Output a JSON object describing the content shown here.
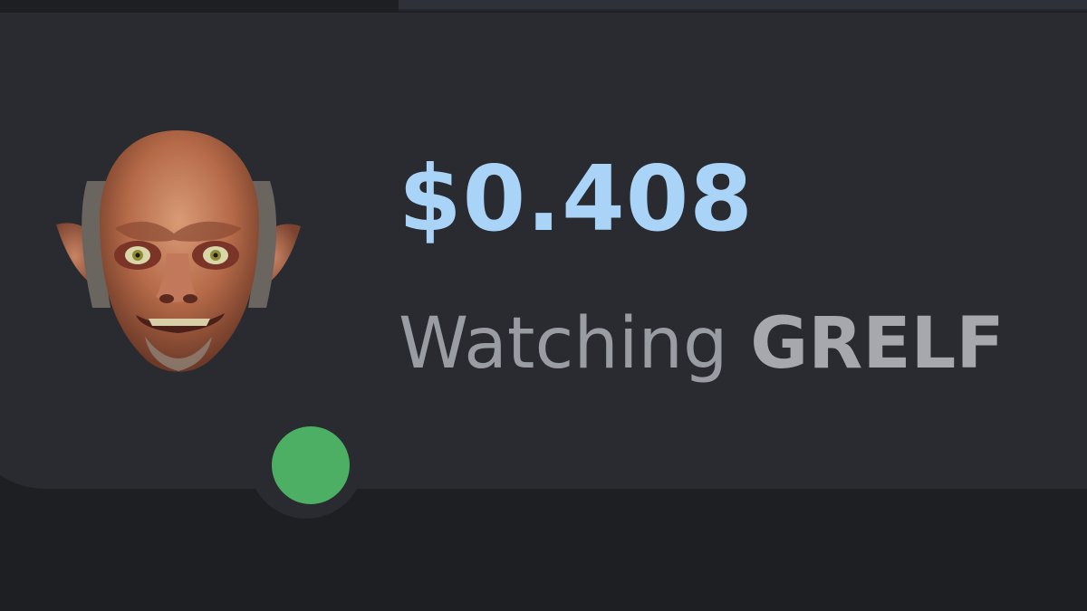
{
  "presence": {
    "price": "$0.408",
    "activity_verb": "Watching",
    "activity_target": "GRELF",
    "status": "online",
    "status_color": "#4caf64",
    "price_color": "#a9d4f7",
    "avatar_icon": "goblin-face-avatar"
  }
}
